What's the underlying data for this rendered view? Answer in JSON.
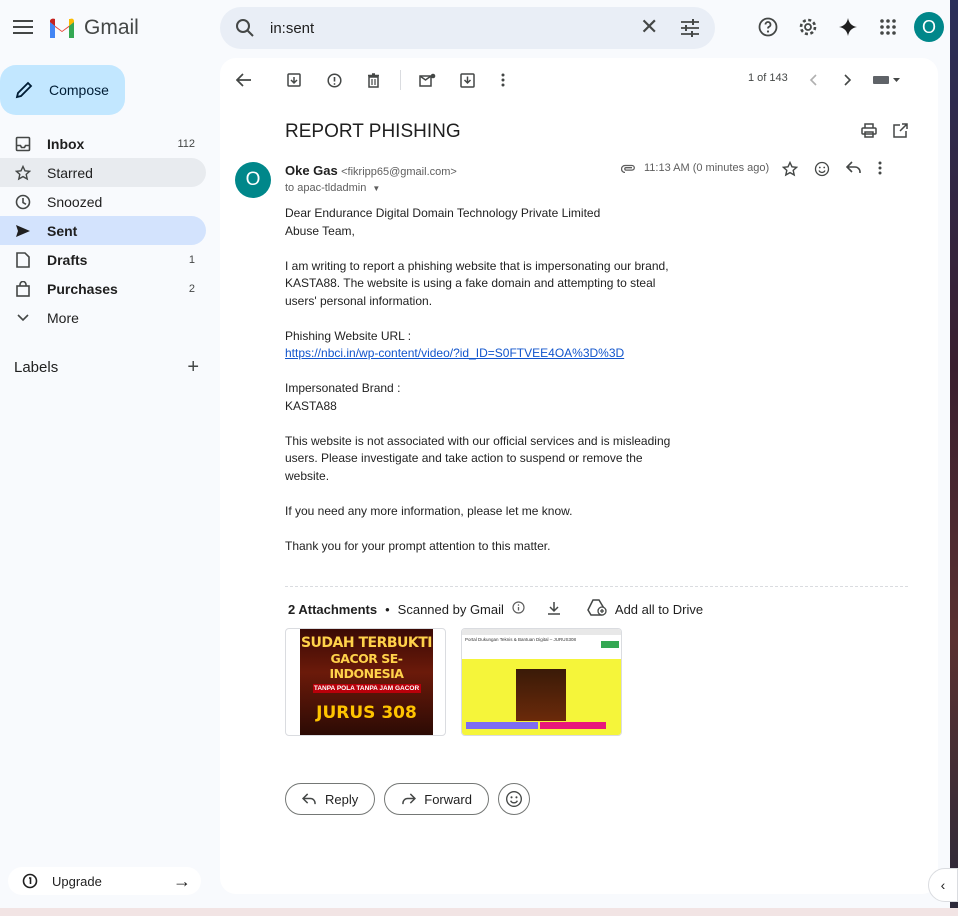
{
  "app": {
    "name": "Gmail"
  },
  "search": {
    "value": "in:sent"
  },
  "user": {
    "initial": "O"
  },
  "compose": {
    "label": "Compose"
  },
  "sidebar": {
    "items": [
      {
        "label": "Inbox",
        "count": "112",
        "bold": true,
        "icon": "inbox-icon"
      },
      {
        "label": "Starred",
        "count": "",
        "bold": false,
        "icon": "star-icon"
      },
      {
        "label": "Snoozed",
        "count": "",
        "bold": false,
        "icon": "clock-icon"
      },
      {
        "label": "Sent",
        "count": "",
        "bold": true,
        "icon": "send-icon",
        "active": true
      },
      {
        "label": "Drafts",
        "count": "1",
        "bold": true,
        "icon": "draft-icon"
      },
      {
        "label": "Purchases",
        "count": "2",
        "bold": true,
        "icon": "bag-icon"
      },
      {
        "label": "More",
        "count": "",
        "bold": false,
        "icon": "chevron-down-icon"
      }
    ],
    "labels_title": "Labels",
    "upgrade_label": "Upgrade"
  },
  "toolbar": {
    "pager": "1 of 143"
  },
  "email": {
    "subject": "REPORT PHISHING",
    "sender_initial": "O",
    "sender_name": "Oke Gas",
    "sender_email": "<fikripp65@gmail.com>",
    "to": "to apac-tldadmin",
    "time": "11:13 AM (0 minutes ago)",
    "greeting": "Dear Endurance Digital Domain Technology Private Limited",
    "greeting2": "Abuse Team,",
    "para1": "I am writing to report a phishing website that is impersonating our brand, KASTA88. The website is using a fake domain and attempting to steal users' personal information.",
    "url_label": "Phishing Website URL :",
    "url": "https://nbci.in/wp-content/video/?id_ID=S0FTVEE4OA%3D%3D",
    "brand_label": "Impersonated Brand :",
    "brand": "KASTA88",
    "para2": "This website is not associated with our official services and is misleading users. Please investigate and take action to suspend or remove the website.",
    "para3": "If you need any more information, please let me know.",
    "para4": "Thank you for your prompt attention to this matter."
  },
  "attachments": {
    "count_label": "2 Attachments",
    "dot": "•",
    "scanned": "Scanned by Gmail",
    "add_drive": "Add all to Drive",
    "thumb1_text1": "SUDAH TERBUKTI",
    "thumb1_text2": "GACOR SE-INDONESIA",
    "thumb1_text3": "TANPA POLA TANPA JAM GACOR",
    "thumb1_text4": "JURUS 308",
    "thumb2_title": "Portal Dukungan Teknis & Bantuan Digital – JURUS308"
  },
  "actions": {
    "reply": "Reply",
    "forward": "Forward"
  }
}
